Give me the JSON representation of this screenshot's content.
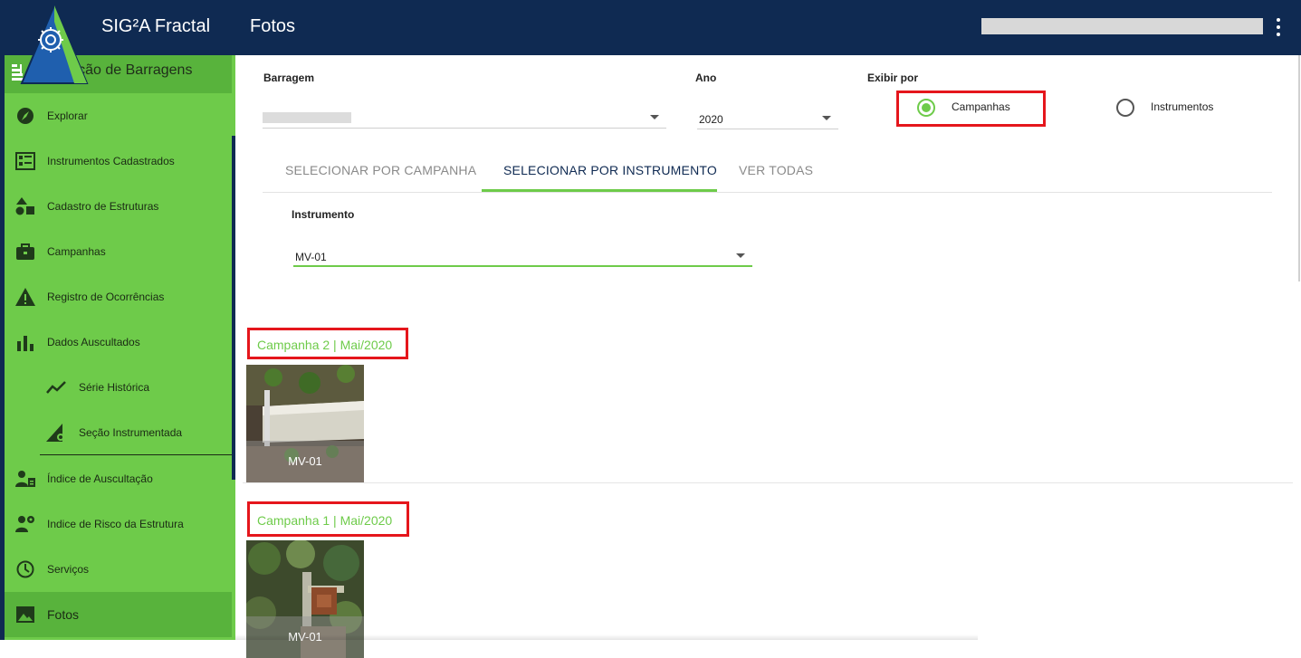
{
  "header": {
    "app_title": "SIG²A Fractal",
    "page_title": "Fotos",
    "colors": {
      "topbar": "#0f2a52",
      "accent": "#6ecb4a"
    }
  },
  "sidebar": {
    "section_title": "Inspeção de Barragens",
    "items": [
      {
        "label": "Explorar",
        "icon": "compass-icon"
      },
      {
        "label": "Instrumentos Cadastrados",
        "icon": "instruments-grid-icon"
      },
      {
        "label": "Cadastro de Estruturas",
        "icon": "shapes-icon"
      },
      {
        "label": "Campanhas",
        "icon": "briefcase-icon"
      },
      {
        "label": "Registro de Ocorrências",
        "icon": "warning-icon"
      },
      {
        "label": "Dados Auscultados",
        "icon": "bar-chart-icon"
      },
      {
        "label": "Série Histórica",
        "icon": "trend-line-icon"
      },
      {
        "label": "Seção Instrumentada",
        "icon": "section-gear-icon"
      },
      {
        "label": "Índice de Auscultação",
        "icon": "engineer-report-icon"
      },
      {
        "label": "Indice de Risco da Estrutura",
        "icon": "engineer-gear-icon"
      },
      {
        "label": "Serviços",
        "icon": "clock-icon"
      },
      {
        "label": "Fotos",
        "icon": "image-icon"
      }
    ]
  },
  "filters": {
    "barragem_label": "Barragem",
    "ano_label": "Ano",
    "ano_value": "2020",
    "exibir_label": "Exibir por",
    "option_campanhas": "Campanhas",
    "option_instrumentos": "Instrumentos"
  },
  "tabs": [
    {
      "label": "SELECIONAR POR CAMPANHA"
    },
    {
      "label": "SELECIONAR POR INSTRUMENTO"
    },
    {
      "label": "VER TODAS"
    }
  ],
  "instrument_filter": {
    "label": "Instrumento",
    "value": "MV-01"
  },
  "campaigns": [
    {
      "title": "Campanha 2 | Mai/2020",
      "photo_caption": "MV-01"
    },
    {
      "title": "Campanha 1 | Mai/2020",
      "photo_caption": "MV-01"
    }
  ]
}
